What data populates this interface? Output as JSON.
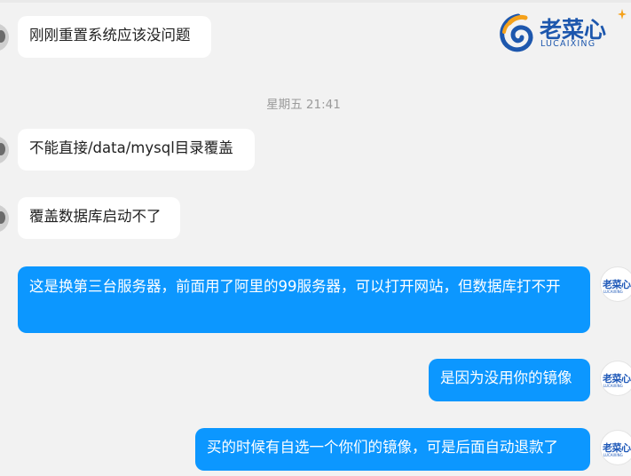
{
  "logo": {
    "title": "老菜心",
    "subtitle": "LUCAIXING",
    "brand_color": "#1d57ad",
    "accent_color": "#f5a11a",
    "mark_icon": "logo-mark-icon"
  },
  "timestamp": "星期五 21:41",
  "colors": {
    "background": "#f2f2f2",
    "incoming_bubble": "#ffffff",
    "outgoing_bubble": "#0c97ff"
  },
  "messages": [
    {
      "direction": "incoming",
      "text": "刚刚重置系统应该没问题"
    },
    {
      "direction": "incoming",
      "text": "不能直接/data/mysql目录覆盖"
    },
    {
      "direction": "incoming",
      "text": "覆盖数据库启动不了"
    },
    {
      "direction": "outgoing",
      "text": "这是换第三台服务器，前面用了阿里的99服务器，可以打开网站，但数据库打不开"
    },
    {
      "direction": "outgoing",
      "text": "是因为没用你的镜像"
    },
    {
      "direction": "outgoing",
      "text": "买的时候有自选一个你们的镜像，可是后面自动退款了"
    }
  ],
  "avatar_logo": {
    "title": "老菜心",
    "subtitle": "LUCAIXING"
  }
}
